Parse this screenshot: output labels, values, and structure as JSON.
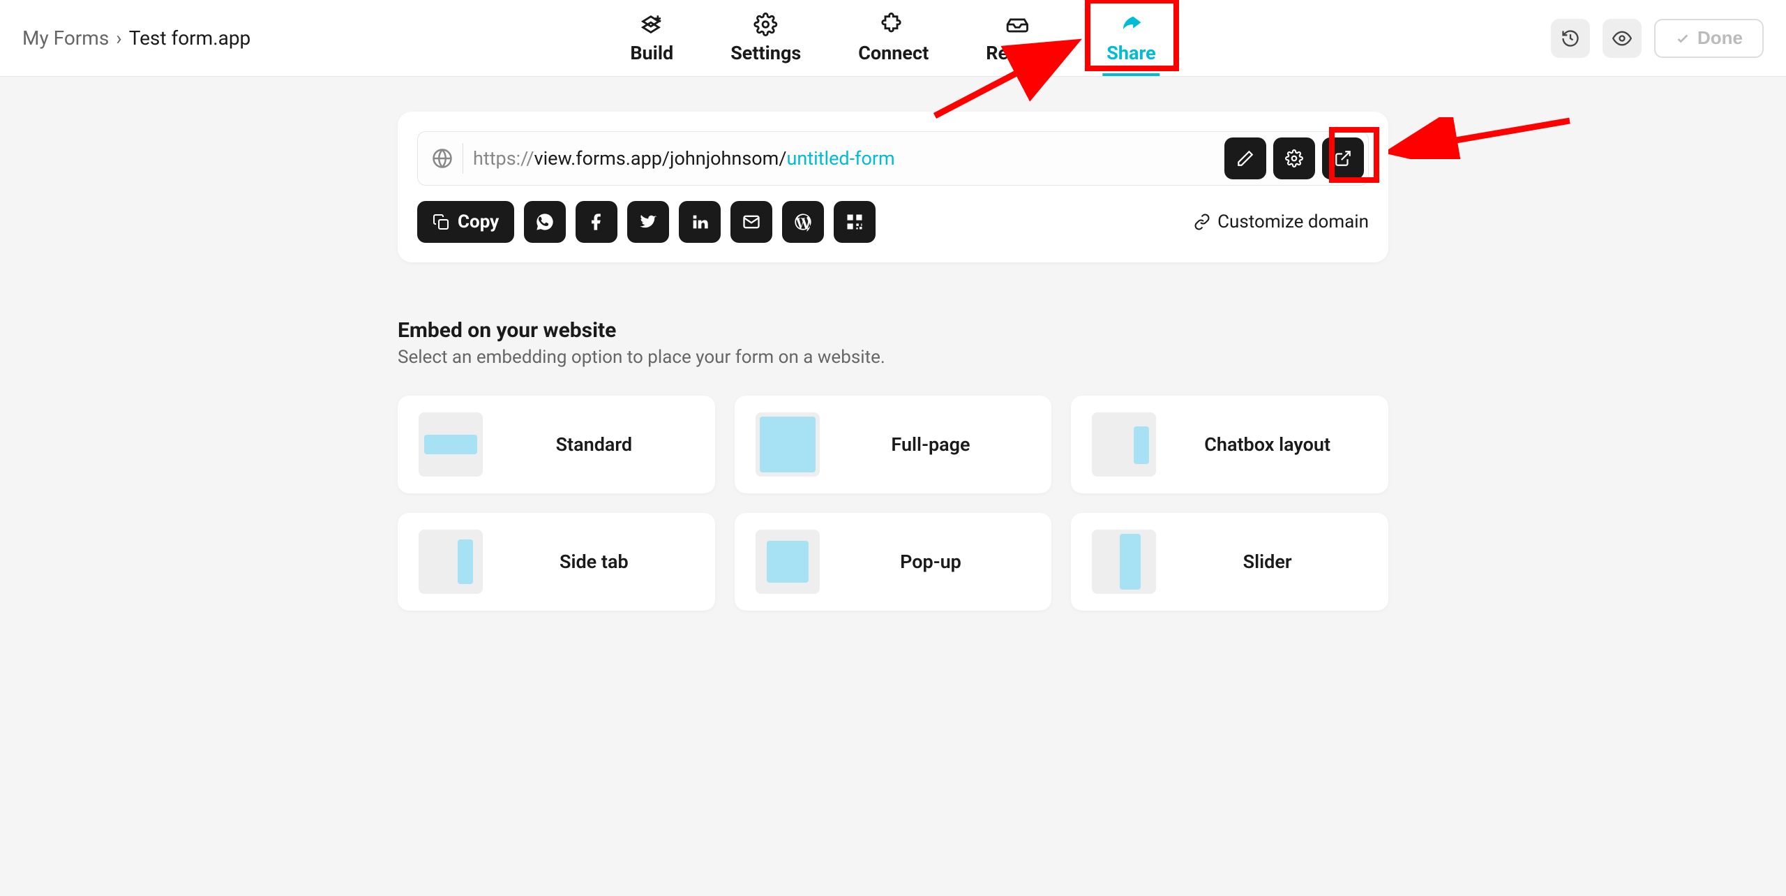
{
  "breadcrumb": {
    "root": "My Forms",
    "sep": "›",
    "current": "Test form.app"
  },
  "tabs": {
    "build": "Build",
    "settings": "Settings",
    "connect": "Connect",
    "results": "Results",
    "share": "Share"
  },
  "header": {
    "done": "Done"
  },
  "url": {
    "prefix": "https://",
    "host": "view.forms.app/johnjohnsom/",
    "slug": "untitled-form"
  },
  "actions": {
    "copy": "Copy",
    "customize": "Customize domain"
  },
  "icons": {
    "copy": "copy-icon",
    "whatsapp": "whatsapp-icon",
    "facebook": "facebook-icon",
    "twitter": "twitter-icon",
    "linkedin": "linkedin-icon",
    "email": "email-icon",
    "wordpress": "wordpress-icon",
    "qr": "qr-icon",
    "pencil": "pencil-icon",
    "gear": "gear-icon",
    "open": "open-external-icon",
    "link": "link-icon",
    "globe": "globe-icon"
  },
  "embed": {
    "title": "Embed on your website",
    "subtitle": "Select an embedding option to place your form on a website.",
    "options": {
      "standard": "Standard",
      "fullpage": "Full-page",
      "chatbox": "Chatbox layout",
      "sidetab": "Side tab",
      "popup": "Pop-up",
      "slider": "Slider"
    }
  }
}
